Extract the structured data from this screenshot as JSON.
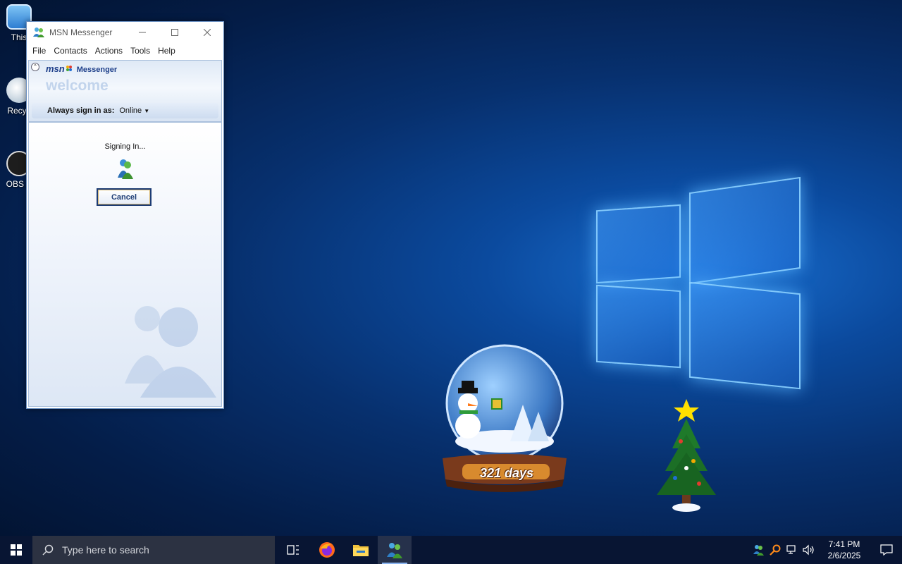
{
  "desktop": {
    "icons": [
      {
        "label": "This"
      },
      {
        "label": "Recyc"
      },
      {
        "label": "OBS S"
      }
    ]
  },
  "msn_window": {
    "title": "MSN Messenger",
    "menu": [
      "File",
      "Contacts",
      "Actions",
      "Tools",
      "Help"
    ],
    "brand_msn": "msn",
    "brand_messenger": "Messenger",
    "welcome": "welcome",
    "signin_label": "Always sign in as:",
    "signin_status": "Online",
    "signing_text": "Signing In...",
    "cancel_label": "Cancel"
  },
  "widget": {
    "countdown": "321 days"
  },
  "taskbar": {
    "search_placeholder": "Type here to search",
    "time": "7:41 PM",
    "date": "2/6/2025",
    "pinned": [
      "task-view",
      "firefox",
      "file-explorer",
      "msn-messenger"
    ]
  },
  "colors": {
    "taskbar_bg": "#081533",
    "msn_blue": "#1e3f8a",
    "desktop_glow": "#1a6fd0"
  }
}
